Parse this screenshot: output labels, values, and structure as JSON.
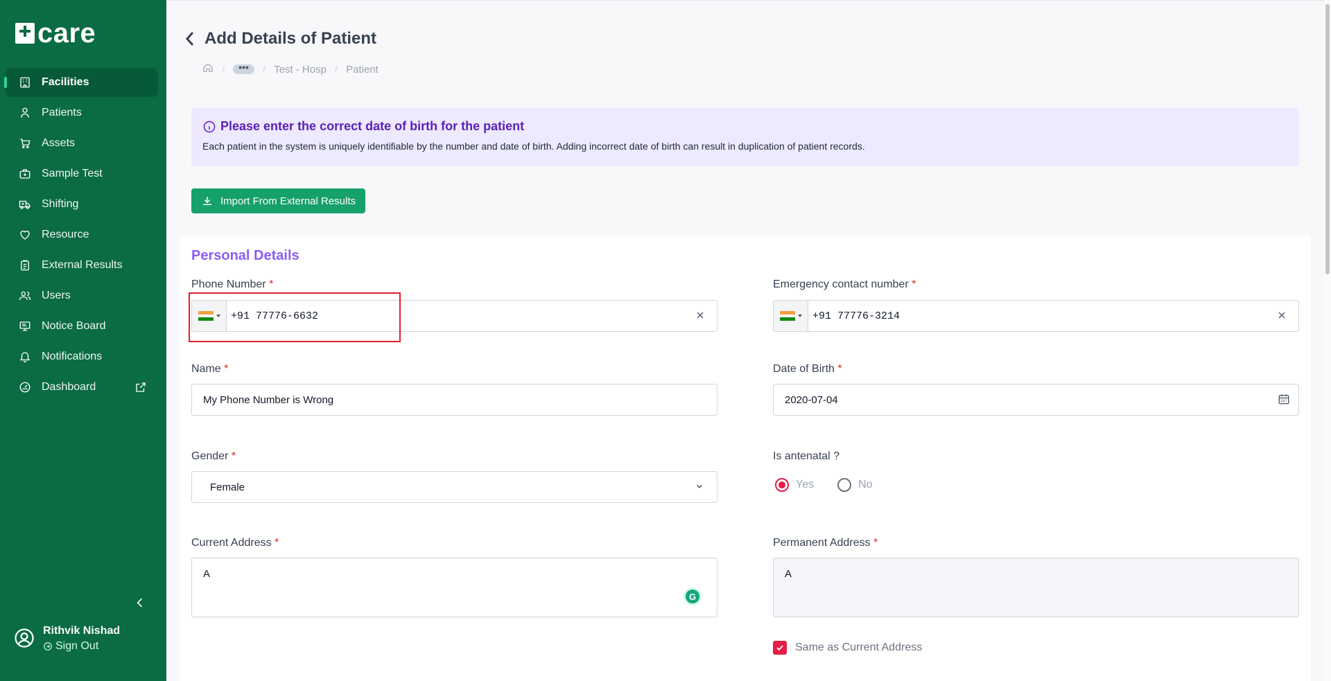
{
  "app": {
    "logo_text": "care"
  },
  "sidebar": {
    "items": [
      {
        "label": "Facilities",
        "icon": "building-icon"
      },
      {
        "label": "Patients",
        "icon": "patient-icon"
      },
      {
        "label": "Assets",
        "icon": "cart-icon"
      },
      {
        "label": "Sample Test",
        "icon": "medkit-icon"
      },
      {
        "label": "Shifting",
        "icon": "ambulance-icon"
      },
      {
        "label": "Resource",
        "icon": "heart-icon"
      },
      {
        "label": "External Results",
        "icon": "clipboard-icon"
      },
      {
        "label": "Users",
        "icon": "users-icon"
      },
      {
        "label": "Notice Board",
        "icon": "monitor-icon"
      },
      {
        "label": "Notifications",
        "icon": "bell-icon"
      },
      {
        "label": "Dashboard",
        "icon": "dashboard-icon"
      }
    ],
    "user_name": "Rithvik Nishad",
    "sign_out": "Sign Out"
  },
  "header": {
    "title": "Add Details of Patient",
    "breadcrumb": {
      "dots": "•••",
      "items": [
        "Test - Hosp",
        "Patient"
      ]
    }
  },
  "notice": {
    "title": "Please enter the correct date of birth for the patient",
    "body": "Each patient in the system is uniquely identifiable by the number and date of birth. Adding incorrect date of birth can result in duplication of patient records."
  },
  "import_button": "Import From External Results",
  "form": {
    "section_title": "Personal Details",
    "phone": {
      "label": "Phone Number",
      "value": "+91 77776-6632"
    },
    "emergency": {
      "label": "Emergency contact number",
      "value": "+91 77776-3214"
    },
    "name": {
      "label": "Name",
      "value": "My Phone Number is Wrong"
    },
    "dob": {
      "label": "Date of Birth",
      "value": "2020-07-04"
    },
    "gender": {
      "label": "Gender",
      "value": "Female"
    },
    "antenatal": {
      "label": "Is antenatal ?",
      "yes": "Yes",
      "no": "No",
      "selected": "Yes"
    },
    "current_address": {
      "label": "Current Address",
      "value": "A"
    },
    "permanent_address": {
      "label": "Permanent Address",
      "value": "A"
    },
    "same_as_current": "Same as Current Address",
    "required_mark": "*"
  },
  "colors": {
    "sidebar": "#0b6b43",
    "accent": "#16a06a",
    "section": "#8b5cf6",
    "required": "#dc2626",
    "highlight": "#e11d2a"
  }
}
